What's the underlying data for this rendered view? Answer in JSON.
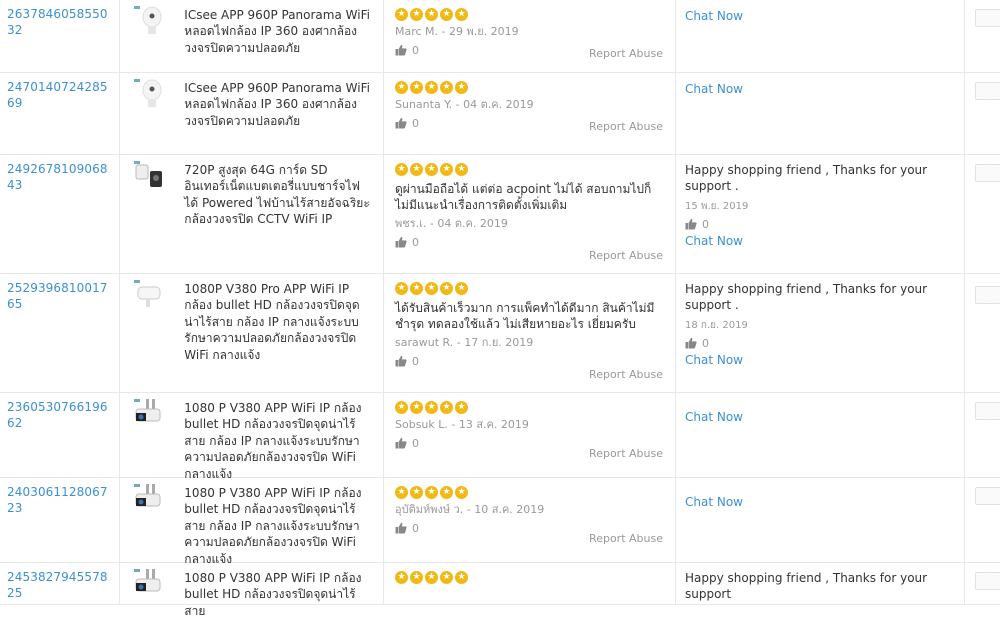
{
  "rows": [
    {
      "order_id": "263784605855032",
      "product_image": "bulb-camera-image",
      "product_name": "ICsee APP 960P Panorama WiFi หลอดไฟกล้อง IP 360 องศากล้องวงจรปิดความปลอดภัย",
      "rating": 5,
      "review_text": "",
      "reviewer": "Marc M. - 29 พ.ย. 2019",
      "likes": "0",
      "report_label": "Report Abuse",
      "reply_text": "",
      "reply_date": "",
      "reply_likes": "",
      "chat_label": "Chat Now"
    },
    {
      "order_id": "247014072428569",
      "product_image": "bulb-camera-image",
      "product_name": "ICsee APP 960P Panorama WiFi หลอดไฟกล้อง IP 360 องศากล้องวงจรปิดความปลอดภัย",
      "rating": 5,
      "review_text": "",
      "reviewer": "Sunanta Y. - 04 ต.ค. 2019",
      "likes": "0",
      "report_label": "Report Abuse",
      "reply_text": "",
      "reply_date": "",
      "reply_likes": "",
      "chat_label": "Chat Now"
    },
    {
      "order_id": "249267810906843",
      "product_image": "mini-camera-image",
      "product_name": "720P สูงสุด 64G การ์ด SD อินเทอร์เน็ตแบตเตอรี่แบบชาร์จไฟได้ Powered ไฟบ้านไร้สายอัจฉริยะกล้องวงจรปิด CCTV WiFi IP",
      "rating": 5,
      "review_text": "ดูผ่านมือถือได้ แต่ต่อ acpoint ไม่ได้ สอบถามไปก็ไม่มีแนะนำเรื่องการติดตั้งเพิ่มเติม",
      "reviewer": "พชร.เ. - 04 ต.ค. 2019",
      "likes": "0",
      "report_label": "Report Abuse",
      "reply_text": "Happy shopping friend , Thanks for your support .",
      "reply_date": "15 พ.ย. 2019",
      "reply_likes": "0",
      "chat_label": "Chat Now"
    },
    {
      "order_id": "252939681001765",
      "product_image": "bullet-camera-white-image",
      "product_name": "1080P V380 Pro APP WiFi IP กล้อง bullet HD กล้องวงจรปิดจุดน่าไร้สาย กล้อง IP กลางแจ้งระบบรักษาความปลอดภัยกล้องวงจรปิด WiFi กลางแจ้ง",
      "rating": 5,
      "review_text": "ได้รับสินค้าเร็วมาก การแพ็คทำได้ดีมาก สินค้าไม่มีชำรุด ทดลองใช้แล้ว ไม่เสียหายอะไร เยี่ยมครับ",
      "reviewer": "sarawut R. - 17 ก.ย. 2019",
      "likes": "0",
      "report_label": "Report Abuse",
      "reply_text": "Happy shopping friend , Thanks for your support .",
      "reply_date": "18 ก.ย. 2019",
      "reply_likes": "0",
      "chat_label": "Chat Now"
    },
    {
      "order_id": "236053076619662",
      "product_image": "bullet-camera-dark-image",
      "product_name": "1080 P V380 APP WiFi IP กล้อง bullet HD กล้องวงจรปิดจุดน่าไร้สาย กล้อง IP กลางแจ้งระบบรักษาความปลอดภัยกล้องวงจรปิด WiFi กลางแจ้ง",
      "rating": 5,
      "review_text": "",
      "reviewer": "Sobsuk L. - 13 ส.ค. 2019",
      "likes": "0",
      "report_label": "Report Abuse",
      "reply_text": "",
      "reply_date": "",
      "reply_likes": "",
      "chat_label": "Chat Now"
    },
    {
      "order_id": "240306112806723",
      "product_image": "bullet-camera-dark-image",
      "product_name": "1080 P V380 APP WiFi IP กล้อง bullet HD กล้องวงจรปิดจุดน่าไร้สาย กล้อง IP กลางแจ้งระบบรักษาความปลอดภัยกล้องวงจรปิด WiFi กลางแจ้ง",
      "rating": 5,
      "review_text": "",
      "reviewer": "อุบัติมห์พงษ์ ว. - 10 ส.ค. 2019",
      "likes": "0",
      "report_label": "Report Abuse",
      "reply_text": "",
      "reply_date": "",
      "reply_likes": "",
      "chat_label": "Chat Now"
    },
    {
      "order_id": "245382794557825",
      "product_image": "bullet-camera-dark-image",
      "product_name": "1080 P V380 APP WiFi IP กล้อง bullet HD กล้องวงจรปิดจุดน่าไร้สาย",
      "rating": 5,
      "review_text": "",
      "reviewer": "",
      "likes": "",
      "report_label": "",
      "reply_text": "Happy shopping friend , Thanks for your support",
      "reply_date": "",
      "reply_likes": "",
      "chat_label": ""
    }
  ],
  "colors": {
    "link": "#3c8fd6",
    "star": "#f0b915",
    "muted": "#999999",
    "border": "#e8e8e8"
  }
}
